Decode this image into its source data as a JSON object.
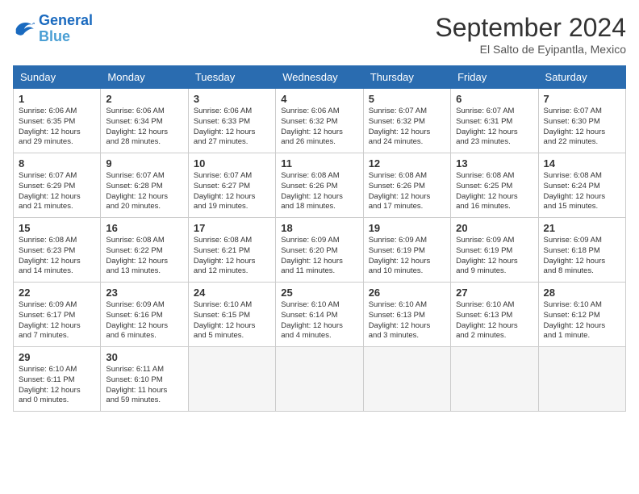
{
  "logo": {
    "line1": "General",
    "line2": "Blue"
  },
  "title": "September 2024",
  "location": "El Salto de Eyipantla, Mexico",
  "headers": [
    "Sunday",
    "Monday",
    "Tuesday",
    "Wednesday",
    "Thursday",
    "Friday",
    "Saturday"
  ],
  "rows": [
    [
      {
        "day": "1",
        "text": "Sunrise: 6:06 AM\nSunset: 6:35 PM\nDaylight: 12 hours\nand 29 minutes."
      },
      {
        "day": "2",
        "text": "Sunrise: 6:06 AM\nSunset: 6:34 PM\nDaylight: 12 hours\nand 28 minutes."
      },
      {
        "day": "3",
        "text": "Sunrise: 6:06 AM\nSunset: 6:33 PM\nDaylight: 12 hours\nand 27 minutes."
      },
      {
        "day": "4",
        "text": "Sunrise: 6:06 AM\nSunset: 6:32 PM\nDaylight: 12 hours\nand 26 minutes."
      },
      {
        "day": "5",
        "text": "Sunrise: 6:07 AM\nSunset: 6:32 PM\nDaylight: 12 hours\nand 24 minutes."
      },
      {
        "day": "6",
        "text": "Sunrise: 6:07 AM\nSunset: 6:31 PM\nDaylight: 12 hours\nand 23 minutes."
      },
      {
        "day": "7",
        "text": "Sunrise: 6:07 AM\nSunset: 6:30 PM\nDaylight: 12 hours\nand 22 minutes."
      }
    ],
    [
      {
        "day": "8",
        "text": "Sunrise: 6:07 AM\nSunset: 6:29 PM\nDaylight: 12 hours\nand 21 minutes."
      },
      {
        "day": "9",
        "text": "Sunrise: 6:07 AM\nSunset: 6:28 PM\nDaylight: 12 hours\nand 20 minutes."
      },
      {
        "day": "10",
        "text": "Sunrise: 6:07 AM\nSunset: 6:27 PM\nDaylight: 12 hours\nand 19 minutes."
      },
      {
        "day": "11",
        "text": "Sunrise: 6:08 AM\nSunset: 6:26 PM\nDaylight: 12 hours\nand 18 minutes."
      },
      {
        "day": "12",
        "text": "Sunrise: 6:08 AM\nSunset: 6:26 PM\nDaylight: 12 hours\nand 17 minutes."
      },
      {
        "day": "13",
        "text": "Sunrise: 6:08 AM\nSunset: 6:25 PM\nDaylight: 12 hours\nand 16 minutes."
      },
      {
        "day": "14",
        "text": "Sunrise: 6:08 AM\nSunset: 6:24 PM\nDaylight: 12 hours\nand 15 minutes."
      }
    ],
    [
      {
        "day": "15",
        "text": "Sunrise: 6:08 AM\nSunset: 6:23 PM\nDaylight: 12 hours\nand 14 minutes."
      },
      {
        "day": "16",
        "text": "Sunrise: 6:08 AM\nSunset: 6:22 PM\nDaylight: 12 hours\nand 13 minutes."
      },
      {
        "day": "17",
        "text": "Sunrise: 6:08 AM\nSunset: 6:21 PM\nDaylight: 12 hours\nand 12 minutes."
      },
      {
        "day": "18",
        "text": "Sunrise: 6:09 AM\nSunset: 6:20 PM\nDaylight: 12 hours\nand 11 minutes."
      },
      {
        "day": "19",
        "text": "Sunrise: 6:09 AM\nSunset: 6:19 PM\nDaylight: 12 hours\nand 10 minutes."
      },
      {
        "day": "20",
        "text": "Sunrise: 6:09 AM\nSunset: 6:19 PM\nDaylight: 12 hours\nand 9 minutes."
      },
      {
        "day": "21",
        "text": "Sunrise: 6:09 AM\nSunset: 6:18 PM\nDaylight: 12 hours\nand 8 minutes."
      }
    ],
    [
      {
        "day": "22",
        "text": "Sunrise: 6:09 AM\nSunset: 6:17 PM\nDaylight: 12 hours\nand 7 minutes."
      },
      {
        "day": "23",
        "text": "Sunrise: 6:09 AM\nSunset: 6:16 PM\nDaylight: 12 hours\nand 6 minutes."
      },
      {
        "day": "24",
        "text": "Sunrise: 6:10 AM\nSunset: 6:15 PM\nDaylight: 12 hours\nand 5 minutes."
      },
      {
        "day": "25",
        "text": "Sunrise: 6:10 AM\nSunset: 6:14 PM\nDaylight: 12 hours\nand 4 minutes."
      },
      {
        "day": "26",
        "text": "Sunrise: 6:10 AM\nSunset: 6:13 PM\nDaylight: 12 hours\nand 3 minutes."
      },
      {
        "day": "27",
        "text": "Sunrise: 6:10 AM\nSunset: 6:13 PM\nDaylight: 12 hours\nand 2 minutes."
      },
      {
        "day": "28",
        "text": "Sunrise: 6:10 AM\nSunset: 6:12 PM\nDaylight: 12 hours\nand 1 minute."
      }
    ],
    [
      {
        "day": "29",
        "text": "Sunrise: 6:10 AM\nSunset: 6:11 PM\nDaylight: 12 hours\nand 0 minutes."
      },
      {
        "day": "30",
        "text": "Sunrise: 6:11 AM\nSunset: 6:10 PM\nDaylight: 11 hours\nand 59 minutes."
      },
      {
        "day": "",
        "text": ""
      },
      {
        "day": "",
        "text": ""
      },
      {
        "day": "",
        "text": ""
      },
      {
        "day": "",
        "text": ""
      },
      {
        "day": "",
        "text": ""
      }
    ]
  ]
}
